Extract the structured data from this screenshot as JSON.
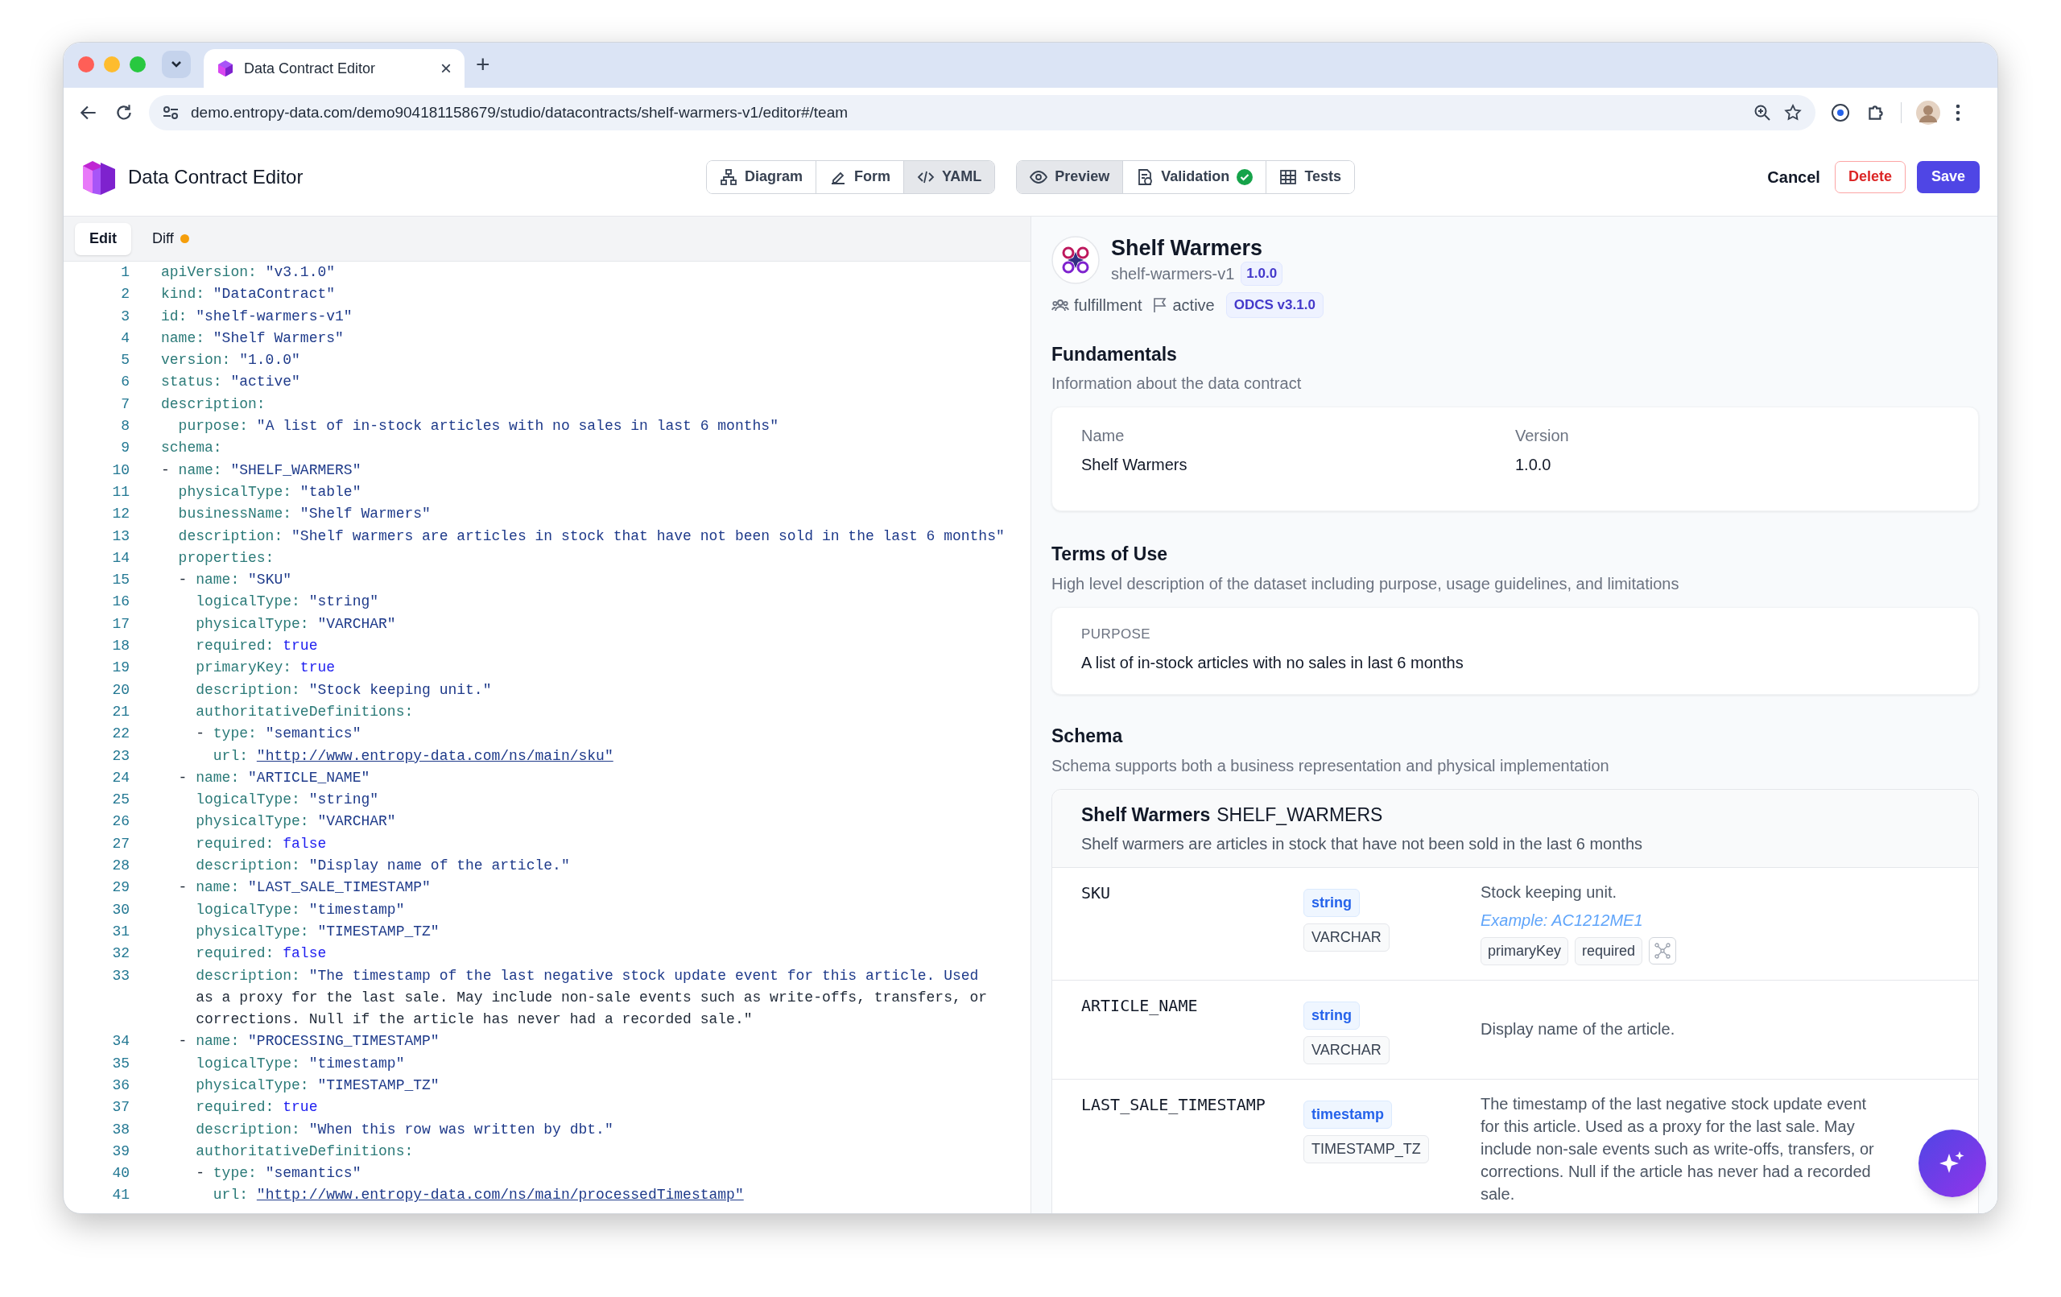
{
  "browser": {
    "tab_title": "Data Contract Editor",
    "tab_close": "×",
    "new_tab": "+",
    "url": "demo.entropy-data.com/demo904181158679/studio/datacontracts/shelf-warmers-v1/editor#/team"
  },
  "app": {
    "title": "Data Contract Editor",
    "view_tabs": [
      {
        "label": "Diagram",
        "selected": false
      },
      {
        "label": "Form",
        "selected": false
      },
      {
        "label": "YAML",
        "selected": true
      }
    ],
    "panel_tabs": [
      {
        "label": "Preview",
        "selected": true
      },
      {
        "label": "Validation",
        "selected": false,
        "passed": true
      },
      {
        "label": "Tests",
        "selected": false
      }
    ],
    "actions": [
      {
        "label": "Cancel",
        "kind": "text"
      },
      {
        "label": "Delete",
        "kind": "danger"
      },
      {
        "label": "Save",
        "kind": "primary"
      }
    ]
  },
  "editor": {
    "tabs": [
      {
        "label": "Edit",
        "selected": true,
        "modified": false
      },
      {
        "label": "Diff",
        "selected": false,
        "modified": true
      }
    ],
    "lines": [
      {
        "number": "1",
        "key": "apiVersion:",
        "value": "\"v3.1.0\"",
        "kind": "string"
      },
      {
        "number": "2",
        "key": "kind:",
        "value": "\"DataContract\"",
        "kind": "string"
      },
      {
        "number": "3",
        "key": "id:",
        "value": "\"shelf-warmers-v1\"",
        "kind": "string"
      },
      {
        "number": "4",
        "key": "name:",
        "value": "\"Shelf Warmers\"",
        "kind": "string"
      },
      {
        "number": "5",
        "key": "version:",
        "value": "\"1.0.0\"",
        "kind": "string"
      },
      {
        "number": "6",
        "key": "status:",
        "value": "\"active\"",
        "kind": "string"
      },
      {
        "number": "7",
        "key": "description:",
        "kind": "map"
      },
      {
        "number": "8",
        "key": "  purpose:",
        "value": "\"A list of in-stock articles with no sales in last 6 months\"",
        "kind": "string"
      },
      {
        "number": "9",
        "key": "schema:",
        "kind": "map"
      },
      {
        "number": "10",
        "prefix": "- ",
        "key": "name:",
        "value": "\"SHELF_WARMERS\"",
        "kind": "string"
      },
      {
        "number": "11",
        "key": "  physicalType:",
        "value": "\"table\"",
        "kind": "string"
      },
      {
        "number": "12",
        "key": "  businessName:",
        "value": "\"Shelf Warmers\"",
        "kind": "string"
      },
      {
        "number": "13",
        "key": "  description:",
        "value": "\"Shelf warmers are articles in stock that have not been sold in the last 6 months\"",
        "kind": "string"
      },
      {
        "number": "14",
        "key": "  properties:",
        "kind": "map"
      },
      {
        "number": "15",
        "prefix": "  - ",
        "key": "name:",
        "value": "\"SKU\"",
        "kind": "string"
      },
      {
        "number": "16",
        "key": "    logicalType:",
        "value": "\"string\"",
        "kind": "string"
      },
      {
        "number": "17",
        "key": "    physicalType:",
        "value": "\"VARCHAR\"",
        "kind": "string"
      },
      {
        "number": "18",
        "key": "    required:",
        "value": "true",
        "kind": "bool"
      },
      {
        "number": "19",
        "key": "    primaryKey:",
        "value": "true",
        "kind": "bool"
      },
      {
        "number": "20",
        "key": "    description:",
        "value": "\"Stock keeping unit.\"",
        "kind": "string"
      },
      {
        "number": "21",
        "key": "    authoritativeDefinitions:",
        "kind": "map"
      },
      {
        "number": "22",
        "prefix": "    - ",
        "key": "type:",
        "value": "\"semantics\"",
        "kind": "string"
      },
      {
        "number": "23",
        "key": "      url:",
        "value": "\"http://www.entropy-data.com/ns/main/sku\"",
        "kind": "link"
      },
      {
        "number": "24",
        "prefix": "  - ",
        "key": "name:",
        "value": "\"ARTICLE_NAME\"",
        "kind": "string"
      },
      {
        "number": "25",
        "key": "    logicalType:",
        "value": "\"string\"",
        "kind": "string"
      },
      {
        "number": "26",
        "key": "    physicalType:",
        "value": "\"VARCHAR\"",
        "kind": "string"
      },
      {
        "number": "27",
        "key": "    required:",
        "value": "false",
        "kind": "bool"
      },
      {
        "number": "28",
        "key": "    description:",
        "value": "\"Display name of the article.\"",
        "kind": "string"
      },
      {
        "number": "29",
        "prefix": "  - ",
        "key": "name:",
        "value": "\"LAST_SALE_TIMESTAMP\"",
        "kind": "string"
      },
      {
        "number": "30",
        "key": "    logicalType:",
        "value": "\"timestamp\"",
        "kind": "string"
      },
      {
        "number": "31",
        "key": "    physicalType:",
        "value": "\"TIMESTAMP_TZ\"",
        "kind": "string"
      },
      {
        "number": "32",
        "key": "    required:",
        "value": "false",
        "kind": "bool"
      },
      {
        "number": "33",
        "key": "    description:",
        "value": "\"The timestamp of the last negative stock update event for this article. Used",
        "kind": "string"
      },
      {
        "value": "as a proxy for the last sale. May include non-sale events such as write-offs, transfers, or",
        "kind": "continuation"
      },
      {
        "value": "corrections. Null if the article has never had a recorded sale.\"",
        "kind": "continuation"
      },
      {
        "number": "34",
        "prefix": "  - ",
        "key": "name:",
        "value": "\"PROCESSING_TIMESTAMP\"",
        "kind": "string"
      },
      {
        "number": "35",
        "key": "    logicalType:",
        "value": "\"timestamp\"",
        "kind": "string"
      },
      {
        "number": "36",
        "key": "    physicalType:",
        "value": "\"TIMESTAMP_TZ\"",
        "kind": "string"
      },
      {
        "number": "37",
        "key": "    required:",
        "value": "true",
        "kind": "bool"
      },
      {
        "number": "38",
        "key": "    description:",
        "value": "\"When this row was written by dbt.\"",
        "kind": "string"
      },
      {
        "number": "39",
        "key": "    authoritativeDefinitions:",
        "kind": "map"
      },
      {
        "number": "40",
        "prefix": "    - ",
        "key": "type:",
        "value": "\"semantics\"",
        "kind": "string"
      },
      {
        "number": "41",
        "key": "      url:",
        "value": "\"http://www.entropy-data.com/ns/main/processedTimestamp\"",
        "kind": "link"
      }
    ]
  },
  "preview": {
    "title": "Shelf Warmers",
    "id": "shelf-warmers-v1",
    "version": "1.0.0",
    "team": "fulfillment",
    "status": "active",
    "standard": "ODCS v3.1.0",
    "fundamentals": {
      "heading": "Fundamentals",
      "subtitle": "Information about the data contract",
      "fields": [
        {
          "label": "Name",
          "value": "Shelf Warmers"
        },
        {
          "label": "Version",
          "value": "1.0.0"
        }
      ]
    },
    "terms": {
      "heading": "Terms of Use",
      "subtitle": "High level description of the dataset including purpose, usage guidelines, and limitations",
      "label": "PURPOSE",
      "value": "A list of in-stock articles with no sales in last 6 months"
    },
    "schema": {
      "heading": "Schema",
      "subtitle": "Schema supports both a business representation and physical implementation",
      "table": {
        "business_name": "Shelf Warmers",
        "physical_name": "SHELF_WARMERS",
        "description": "Shelf warmers are articles in stock that have not been sold in the last 6 months",
        "properties": [
          {
            "name": "SKU",
            "logical_type": "string",
            "physical_type": "VARCHAR",
            "description": "Stock keeping unit.",
            "example": "Example: AC1212ME1",
            "tags": [
              "primaryKey",
              "required"
            ],
            "semantics": true
          },
          {
            "name": "ARTICLE_NAME",
            "logical_type": "string",
            "physical_type": "VARCHAR",
            "description": "Display name of the article."
          },
          {
            "name": "LAST_SALE_TIMESTAMP",
            "logical_type": "timestamp",
            "physical_type": "TIMESTAMP_TZ",
            "description": "The timestamp of the last negative stock update event for this article. Used as a proxy for the last sale. May include non-sale events such as write-offs, transfers, or corrections. Null if the article has never had a recorded sale."
          }
        ]
      }
    }
  }
}
